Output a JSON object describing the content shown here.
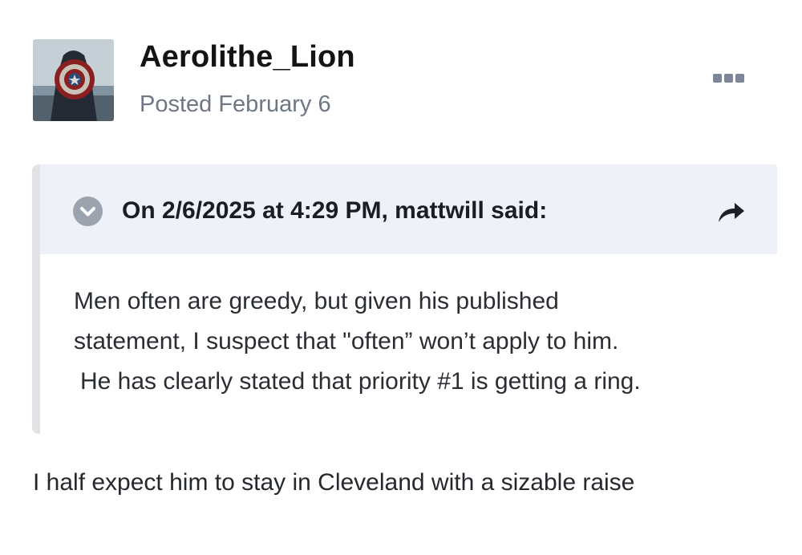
{
  "post": {
    "author": "Aerolithe_Lion",
    "posted_label": "Posted February 6",
    "avatar_icon": "shield-hero-avatar-icon",
    "menu_icon": "more-options-icon"
  },
  "quote": {
    "citation": "On 2/6/2025 at 4:29 PM, mattwill said:",
    "toggle_icon": "chevron-down-icon",
    "share_icon": "share-arrow-icon",
    "lines": [
      "Men often are greedy, but given his published",
      "statement, I suspect that \"often” won’t apply to him.",
      "He has clearly stated that priority #1 is getting a ring."
    ]
  },
  "reply": {
    "text": "I half expect him to stay in Cleveland with a sizable raise"
  },
  "colors": {
    "quote_header_bg": "#eef1f7",
    "quote_border": "#e1e3e7",
    "muted_text": "#6f7785",
    "menu_dots": "#7b8798"
  }
}
